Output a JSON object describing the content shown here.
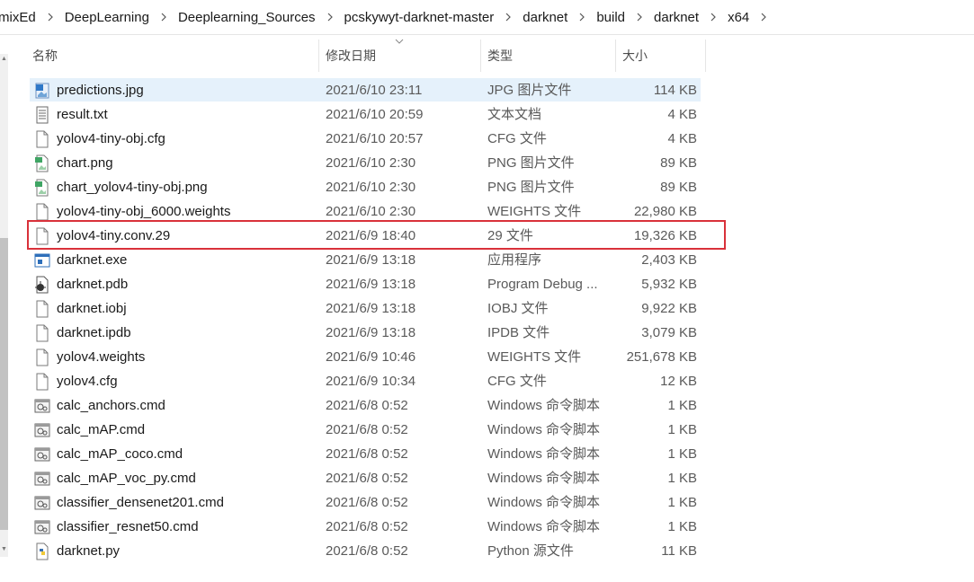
{
  "breadcrumb": [
    "mixEd",
    "DeepLearning",
    "Deeplearning_Sources",
    "pcskywyt-darknet-master",
    "darknet",
    "build",
    "darknet",
    "x64"
  ],
  "columns": {
    "name": "名称",
    "date": "修改日期",
    "type": "类型",
    "size": "大小"
  },
  "files": [
    {
      "name": "predictions.jpg",
      "date": "2021/6/10 23:11",
      "type": "JPG 图片文件",
      "size": "114 KB",
      "icon": "image-file-icon",
      "selected": true
    },
    {
      "name": "result.txt",
      "date": "2021/6/10 20:59",
      "type": "文本文档",
      "size": "4 KB",
      "icon": "text-file-icon"
    },
    {
      "name": "yolov4-tiny-obj.cfg",
      "date": "2021/6/10 20:57",
      "type": "CFG 文件",
      "size": "4 KB",
      "icon": "blank-file-icon"
    },
    {
      "name": "chart.png",
      "date": "2021/6/10 2:30",
      "type": "PNG 图片文件",
      "size": "89 KB",
      "icon": "png-file-icon"
    },
    {
      "name": "chart_yolov4-tiny-obj.png",
      "date": "2021/6/10 2:30",
      "type": "PNG 图片文件",
      "size": "89 KB",
      "icon": "png-file-icon"
    },
    {
      "name": "yolov4-tiny-obj_6000.weights",
      "date": "2021/6/10 2:30",
      "type": "WEIGHTS 文件",
      "size": "22,980 KB",
      "icon": "blank-file-icon"
    },
    {
      "name": "yolov4-tiny.conv.29",
      "date": "2021/6/9 18:40",
      "type": "29 文件",
      "size": "19,326 KB",
      "icon": "blank-file-icon",
      "highlighted": true
    },
    {
      "name": "darknet.exe",
      "date": "2021/6/9 13:18",
      "type": "应用程序",
      "size": "2,403 KB",
      "icon": "exe-file-icon"
    },
    {
      "name": "darknet.pdb",
      "date": "2021/6/9 13:18",
      "type": "Program Debug ...",
      "size": "5,932 KB",
      "icon": "pdb-file-icon"
    },
    {
      "name": "darknet.iobj",
      "date": "2021/6/9 13:18",
      "type": "IOBJ 文件",
      "size": "9,922 KB",
      "icon": "blank-file-icon"
    },
    {
      "name": "darknet.ipdb",
      "date": "2021/6/9 13:18",
      "type": "IPDB 文件",
      "size": "3,079 KB",
      "icon": "blank-file-icon"
    },
    {
      "name": "yolov4.weights",
      "date": "2021/6/9 10:46",
      "type": "WEIGHTS 文件",
      "size": "251,678 KB",
      "icon": "blank-file-icon"
    },
    {
      "name": "yolov4.cfg",
      "date": "2021/6/9 10:34",
      "type": "CFG 文件",
      "size": "12 KB",
      "icon": "blank-file-icon"
    },
    {
      "name": "calc_anchors.cmd",
      "date": "2021/6/8 0:52",
      "type": "Windows 命令脚本",
      "size": "1 KB",
      "icon": "cmd-file-icon"
    },
    {
      "name": "calc_mAP.cmd",
      "date": "2021/6/8 0:52",
      "type": "Windows 命令脚本",
      "size": "1 KB",
      "icon": "cmd-file-icon"
    },
    {
      "name": "calc_mAP_coco.cmd",
      "date": "2021/6/8 0:52",
      "type": "Windows 命令脚本",
      "size": "1 KB",
      "icon": "cmd-file-icon"
    },
    {
      "name": "calc_mAP_voc_py.cmd",
      "date": "2021/6/8 0:52",
      "type": "Windows 命令脚本",
      "size": "1 KB",
      "icon": "cmd-file-icon"
    },
    {
      "name": "classifier_densenet201.cmd",
      "date": "2021/6/8 0:52",
      "type": "Windows 命令脚本",
      "size": "1 KB",
      "icon": "cmd-file-icon"
    },
    {
      "name": "classifier_resnet50.cmd",
      "date": "2021/6/8 0:52",
      "type": "Windows 命令脚本",
      "size": "1 KB",
      "icon": "cmd-file-icon"
    },
    {
      "name": "darknet.py",
      "date": "2021/6/8 0:52",
      "type": "Python 源文件",
      "size": "11 KB",
      "icon": "python-file-icon"
    }
  ],
  "colors": {
    "selection": "#e5f1fb",
    "highlight_border": "#d9313a",
    "secondary_text": "#5a5a5a"
  }
}
